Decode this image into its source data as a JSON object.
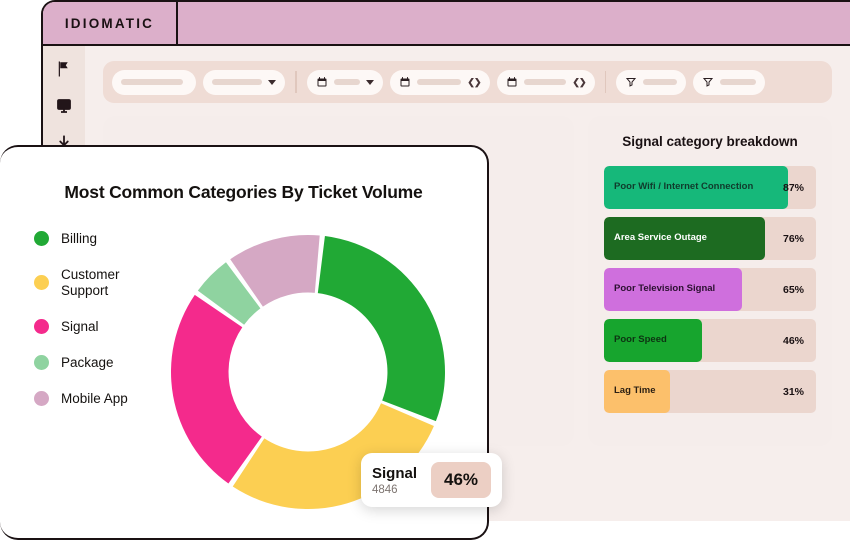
{
  "window": {
    "logo": "IDIOMATIC",
    "sidebar": [
      {
        "icon": "flag-icon",
        "name": "flag"
      },
      {
        "icon": "monitor-icon",
        "name": "monitor"
      },
      {
        "icon": "download-icon",
        "name": "download"
      }
    ]
  },
  "toolbar": {
    "controls": [
      {
        "type": "text",
        "icon": null
      },
      {
        "type": "dropdown",
        "icon": null
      },
      {
        "type": "date-dropdown",
        "icon": "calendar-icon"
      },
      {
        "type": "date-range",
        "icon": "calendar-icon"
      },
      {
        "type": "date-range",
        "icon": "calendar-icon"
      },
      {
        "type": "filter",
        "icon": "funnel-icon"
      },
      {
        "type": "filter",
        "icon": "funnel-icon"
      }
    ]
  },
  "breakdown_panel": {
    "title": "Signal category breakdown"
  },
  "donut_card": {
    "title": "Most Common Categories By Ticket Volume",
    "tooltip": {
      "label": "Signal",
      "count": "4846",
      "percent": "46%"
    }
  },
  "chart_data": [
    {
      "type": "pie",
      "title": "Most Common Categories By Ticket Volume",
      "categories": [
        "Billing",
        "Customer Support",
        "Signal",
        "Package",
        "Mobile App"
      ],
      "values": [
        28,
        27,
        24,
        5,
        11
      ],
      "colors": [
        "#21a935",
        "#fccf52",
        "#f42a8c",
        "#8fd3a0",
        "#d5a8c4"
      ],
      "legend_position": "left",
      "hole_ratio": 0.58,
      "highlight": {
        "category": "Signal",
        "count": 4846,
        "percent": 46
      }
    },
    {
      "type": "bar",
      "title": "Signal category breakdown",
      "orientation": "horizontal",
      "categories": [
        "Poor Wifi / Internet Connection",
        "Area Service Outage",
        "Poor Television Signal",
        "Poor Speed",
        "Lag Time"
      ],
      "values": [
        87,
        76,
        65,
        46,
        31
      ],
      "value_labels": [
        "87%",
        "76%",
        "65%",
        "46%",
        "31%"
      ],
      "colors": [
        "#16b87a",
        "#1d6b21",
        "#cf6fdd",
        "#17a52e",
        "#fcc06b"
      ],
      "label_colors": [
        "#103b2c",
        "#ffffff",
        "#2b1030",
        "#0d3312",
        "#2c2013"
      ],
      "track_color": "#ebd6ce",
      "xlim": [
        0,
        100
      ],
      "grid": false
    }
  ]
}
